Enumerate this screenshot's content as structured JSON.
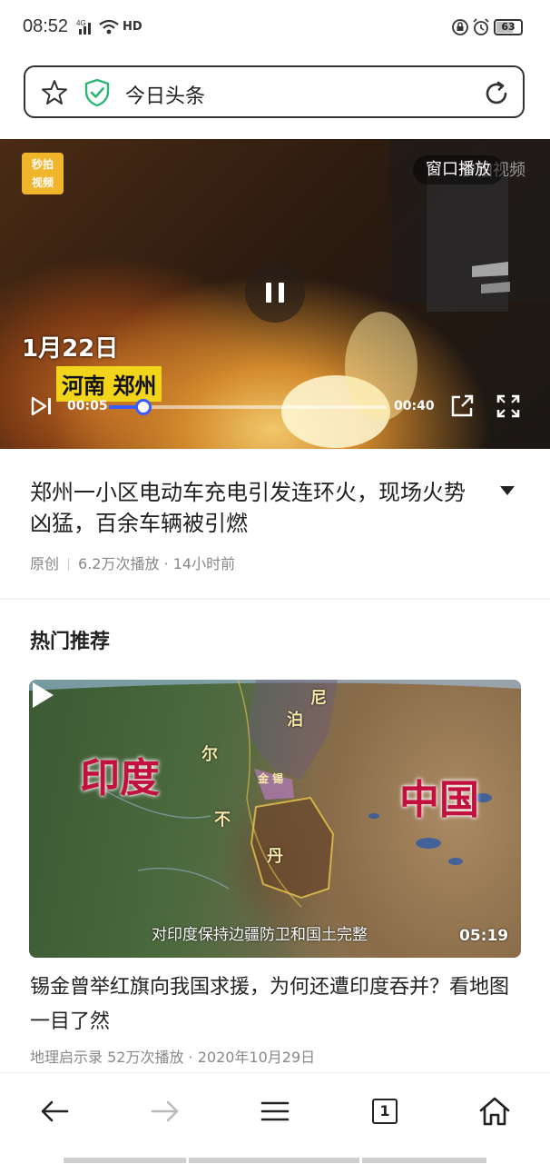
{
  "status_bar": {
    "time": "08:52",
    "network": "4G",
    "hd": "HD",
    "battery": "63"
  },
  "address_bar": {
    "text": "今日头条"
  },
  "video": {
    "badge": "秒拍\n视频",
    "window_play": "窗口播放",
    "watermark": "秒拍视频",
    "date_caption": "1月22日",
    "location_caption": "河南 郑州",
    "current_time": "00:05",
    "duration": "00:40",
    "progress": 0.125
  },
  "article": {
    "title": "郑州一小区电动车充电引发连环火，现场火势凶猛，百余车辆被引燃",
    "source": "原创",
    "stats": "6.2万次播放 · 14小时前"
  },
  "recommended": {
    "section_title": "热门推荐",
    "card": {
      "map_labels": {
        "india": "印度",
        "china": "中国",
        "nepal_1": "尼",
        "nepal_2": "泊",
        "nepal_3": "尔",
        "sikkim": "金 锡",
        "bhutan_1": "不",
        "bhutan_2": "丹"
      },
      "subtitle": "对印度保持边疆防卫和国土完整",
      "duration": "05:19",
      "title": "锡金曾举红旗向我国求援，为何还遭印度吞并？看地图一目了然",
      "meta": "地理启示录  52万次播放 · 2020年10月29日"
    }
  },
  "bottom_nav": {
    "tab_count": "1"
  },
  "colors": {
    "accent": "#3a5cff",
    "shield_green": "#2bb673",
    "caption_yellow": "#f2d51b"
  }
}
